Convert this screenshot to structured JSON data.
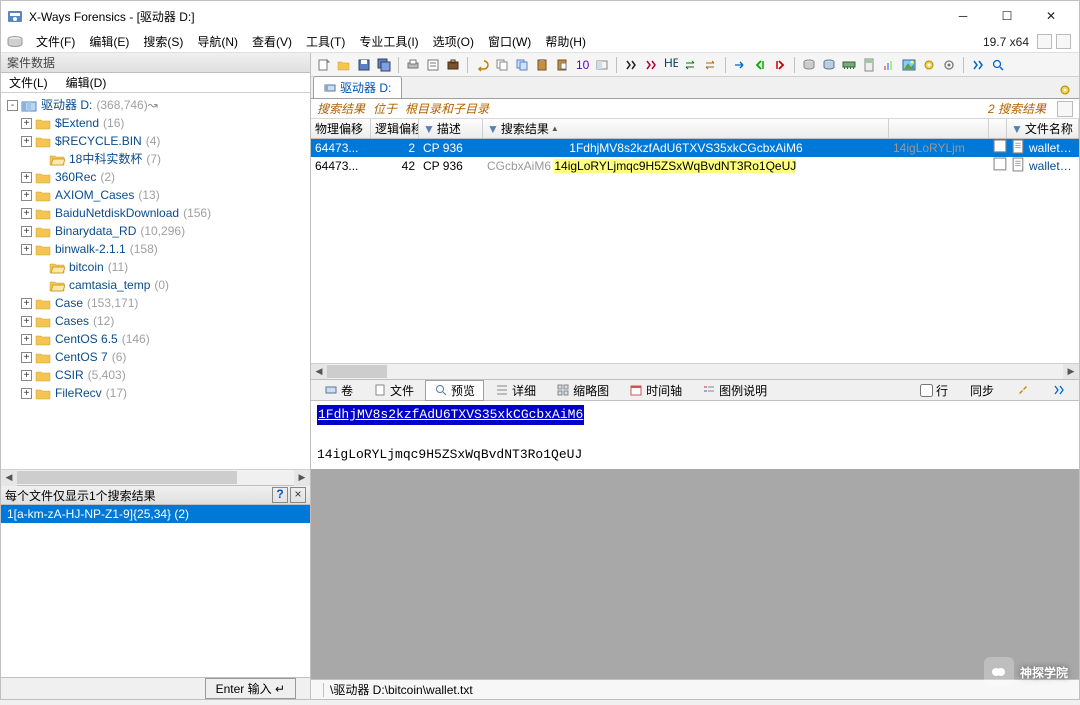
{
  "title": "X-Ways Forensics - [驱动器 D:]",
  "version": "19.7 x64",
  "menu": [
    "文件(F)",
    "编辑(E)",
    "搜索(S)",
    "导航(N)",
    "查看(V)",
    "工具(T)",
    "专业工具(I)",
    "选项(O)",
    "窗口(W)",
    "帮助(H)"
  ],
  "left": {
    "header": "案件数据",
    "submenu": {
      "file": "文件(L)",
      "edit": "编辑(D)"
    },
    "tree": [
      {
        "exp": "-",
        "ind": 0,
        "name": "驱动器 D:",
        "count": "(368,746)",
        "root": true
      },
      {
        "exp": "+",
        "ind": 1,
        "name": "$Extend",
        "count": "(16)"
      },
      {
        "exp": "+",
        "ind": 1,
        "name": "$RECYCLE.BIN",
        "count": "(4)"
      },
      {
        "exp": "",
        "ind": 2,
        "name": "18中科实数杯",
        "count": "(7)",
        "open": true
      },
      {
        "exp": "+",
        "ind": 1,
        "name": "360Rec",
        "count": "(2)"
      },
      {
        "exp": "+",
        "ind": 1,
        "name": "AXIOM_Cases",
        "count": "(13)"
      },
      {
        "exp": "+",
        "ind": 1,
        "name": "BaiduNetdiskDownload",
        "count": "(156)"
      },
      {
        "exp": "+",
        "ind": 1,
        "name": "Binarydata_RD",
        "count": "(10,296)"
      },
      {
        "exp": "+",
        "ind": 1,
        "name": "binwalk-2.1.1",
        "count": "(158)"
      },
      {
        "exp": "",
        "ind": 2,
        "name": "bitcoin",
        "count": "(11)",
        "open": true
      },
      {
        "exp": "",
        "ind": 2,
        "name": "camtasia_temp",
        "count": "(0)",
        "open": true
      },
      {
        "exp": "+",
        "ind": 1,
        "name": "Case",
        "count": "(153,171)"
      },
      {
        "exp": "+",
        "ind": 1,
        "name": "Cases",
        "count": "(12)"
      },
      {
        "exp": "+",
        "ind": 1,
        "name": "CentOS 6.5",
        "count": "(146)"
      },
      {
        "exp": "+",
        "ind": 1,
        "name": "CentOS 7",
        "count": "(6)"
      },
      {
        "exp": "+",
        "ind": 1,
        "name": "CSIR",
        "count": "(5,403)"
      },
      {
        "exp": "+",
        "ind": 1,
        "name": "FileRecv",
        "count": "(17)"
      }
    ],
    "search_header": "每个文件仅显示1个搜索结果",
    "search_item": "1[a-km-zA-HJ-NP-Z1-9]{25,34} (2)",
    "enter": "Enter 输入 ↵"
  },
  "tabs": {
    "drive": "驱动器 D:"
  },
  "crumbs": {
    "a": "搜索结果",
    "b": "位于",
    "c": "根目录和子目录",
    "count": "2",
    "label": "搜索结果"
  },
  "cols": {
    "po": "物理偏移",
    "lo": "逻辑偏移",
    "desc": "描述",
    "res": "搜索结果",
    "fname": "文件名称"
  },
  "rows": [
    {
      "po": "64473...",
      "lo": "2",
      "desc": "CP 936",
      "res": "1FdhjMV8s2kzfAdU6TXVS35xkCGcbxAiM6",
      "res2": "14igLoRYLjm",
      "fname": "wallet.txt",
      "sel": true
    },
    {
      "po": "64473...",
      "lo": "42",
      "desc": "CP 936",
      "pre": "CGcbxAiM6",
      "res": "14igLoRYLjmqc9H5ZSxWqBvdNT3Ro1QeUJ",
      "fname": "wallet.txt",
      "sel": false,
      "hl": true
    }
  ],
  "dtabs": {
    "vol": "卷",
    "file": "文件",
    "preview": "预览",
    "detail": "详细",
    "thumb": "缩略图",
    "timeline": "时间轴",
    "legend": "图例说明",
    "line": "行",
    "sync": "同步"
  },
  "preview": {
    "l1": "1FdhjMV8s2kzfAdU6TXVS35xkCGcbxAiM6",
    "l2": "14igLoRYLjmqc9H5ZSxWqBvdNT3Ro1QeUJ"
  },
  "status": "\\驱动器 D:\\bitcoin\\wallet.txt",
  "watermark": "神探学院"
}
